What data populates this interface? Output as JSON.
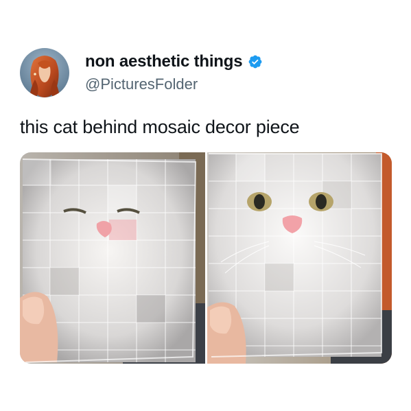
{
  "tweet": {
    "display_name": "non aesthetic things",
    "handle": "@PicturesFolder",
    "text": "this cat behind mosaic decor piece",
    "verified": true
  },
  "icons": {
    "avatar": "profile-avatar-red-hair-woman",
    "verified": "verified-badge-icon"
  },
  "media": {
    "count": 2,
    "description_left": "cat face seen through mosaic glass block, far",
    "description_right": "cat face seen through mosaic glass block, close"
  },
  "colors": {
    "text": "#0f1419",
    "secondary": "#536471",
    "verified_blue": "#1d9bf0",
    "background": "#ffffff"
  }
}
